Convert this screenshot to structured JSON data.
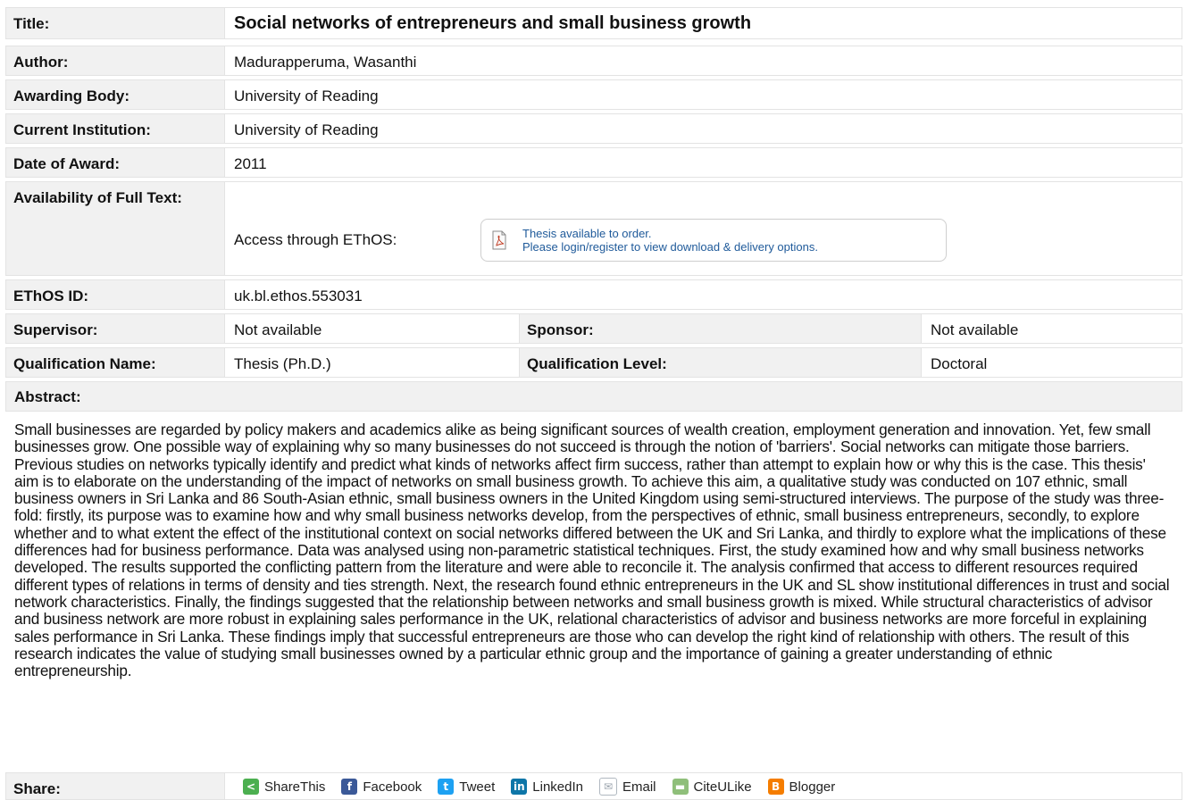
{
  "record": {
    "title_label": "Title:",
    "title": "Social networks of entrepreneurs and small business growth",
    "author_label": "Author:",
    "author": "Madurapperuma, Wasanthi",
    "awarding_body_label": "Awarding Body:",
    "awarding_body": "University of Reading",
    "current_institution_label": "Current Institution:",
    "current_institution": "University of Reading",
    "date_label": "Date of Award:",
    "date": "2011",
    "availability_label": "Availability of Full Text:",
    "access_label": "Access through EThOS:",
    "access_line1": "Thesis available to order.",
    "access_line2": "Please login/register to view download & delivery options.",
    "ethos_id_label": "EThOS ID:",
    "ethos_id": "uk.bl.ethos.553031",
    "supervisor_label": "Supervisor:",
    "supervisor": "Not available",
    "sponsor_label": "Sponsor:",
    "sponsor": "Not available",
    "qual_name_label": "Qualification Name:",
    "qual_name": "Thesis (Ph.D.)",
    "qual_level_label": "Qualification Level:",
    "qual_level": "Doctoral",
    "abstract_label": "Abstract:",
    "abstract": "Small businesses are regarded by policy makers and academics alike as being significant sources of wealth creation, employment generation and innovation. Yet, few small businesses grow. One possible way of explaining why so many businesses do not succeed is through the notion of 'barriers'. Social networks can mitigate those barriers. Previous studies on networks typically identify and predict what kinds of networks affect firm success, rather than attempt to explain how or why this is the case. This thesis' aim is to elaborate on the understanding of the impact of networks on small business growth. To achieve this aim, a qualitative study was conducted on 107 ethnic, small business owners in Sri Lanka and 86 South-Asian ethnic, small business owners in the United Kingdom using semi-structured interviews. The purpose of the study was three-fold: firstly, its purpose was to examine how and why small business networks develop, from the perspectives of ethnic, small business entrepreneurs, secondly, to explore whether and to what extent the effect of the institutional context on social networks differed between the UK and Sri Lanka, and thirdly to explore what the implications of these differences had for business performance. Data was analysed using non-parametric statistical techniques. First, the study examined how and why small business networks developed. The results supported the conflicting pattern from the literature and were able to reconcile it. The analysis confirmed that access to different resources required different types of relations in terms of density and ties strength. Next, the research found ethnic entrepreneurs in the UK and SL show institutional differences in trust and social network characteristics. Finally, the findings suggested that the relationship between networks and small business growth is mixed. While structural characteristics of advisor and business network are more robust in explaining sales performance in the UK, relational characteristics of advisor and business networks are more forceful in explaining sales performance in Sri Lanka. These findings imply that successful entrepreneurs are those who can develop the right kind of relationship with others. The result of this research indicates the value of studying small businesses owned by a particular ethnic group and the importance of gaining a greater understanding of ethnic entrepreneurship.",
    "share_label": "Share:"
  },
  "share": [
    {
      "label": "ShareThis",
      "icon": "sharethis-icon",
      "color": "#4caf50"
    },
    {
      "label": "Facebook",
      "icon": "facebook-icon",
      "color": "#3b5998"
    },
    {
      "label": "Tweet",
      "icon": "twitter-icon",
      "color": "#1da1f2"
    },
    {
      "label": "LinkedIn",
      "icon": "linkedin-icon",
      "color": "#0e76a8"
    },
    {
      "label": "Email",
      "icon": "email-icon",
      "color": "#b0b8c0"
    },
    {
      "label": "CiteULike",
      "icon": "citeulike-icon",
      "color": "#8fbf7a"
    },
    {
      "label": "Blogger",
      "icon": "blogger-icon",
      "color": "#f57d00"
    }
  ]
}
